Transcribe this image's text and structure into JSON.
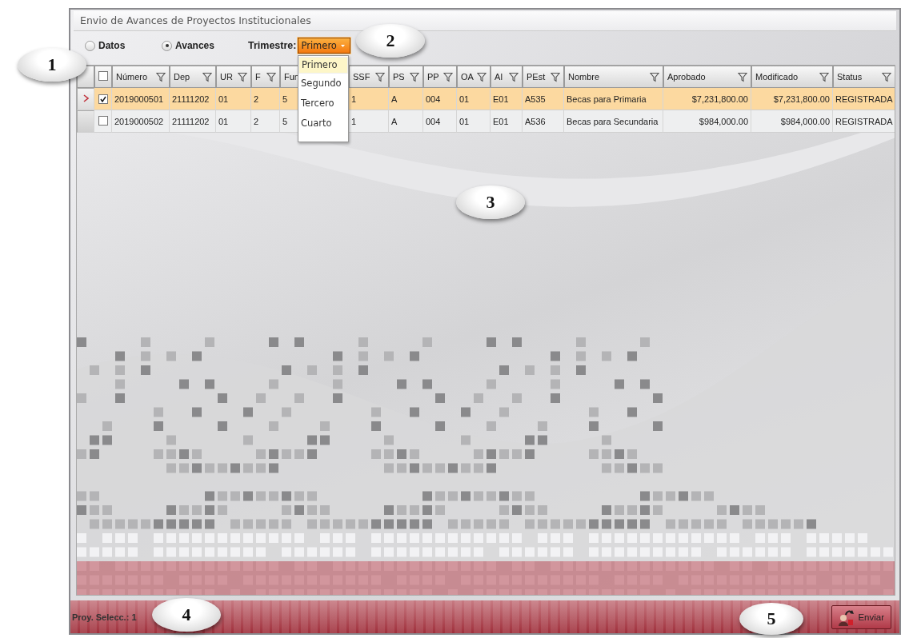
{
  "window": {
    "title": "Envio de Avances de Proyectos Institucionales"
  },
  "mode_options": [
    {
      "label": "Datos",
      "selected": false
    },
    {
      "label": "Avances",
      "selected": true
    }
  ],
  "trimestre": {
    "label": "Trimestre:",
    "value": "Primero",
    "expanded": true,
    "options": [
      {
        "label": "Primero",
        "selected": true
      },
      {
        "label": "Segundo",
        "selected": false
      },
      {
        "label": "Tercero",
        "selected": false
      },
      {
        "label": "Cuarto",
        "selected": false
      }
    ]
  },
  "table": {
    "header_checked": false,
    "columns": [
      {
        "label": "Número",
        "kind": "text"
      },
      {
        "label": "Dep",
        "kind": "text"
      },
      {
        "label": "UR",
        "kind": "text"
      },
      {
        "label": "F",
        "kind": "text"
      },
      {
        "label": "Fun",
        "kind": "text"
      },
      {
        "label": "SSF",
        "kind": "text"
      },
      {
        "label": "PS",
        "kind": "text"
      },
      {
        "label": "PP",
        "kind": "text"
      },
      {
        "label": "OA",
        "kind": "text"
      },
      {
        "label": "AI",
        "kind": "text"
      },
      {
        "label": "PEst",
        "kind": "text"
      },
      {
        "label": "Nombre",
        "kind": "text"
      },
      {
        "label": "Aprobado",
        "kind": "money"
      },
      {
        "label": "Modificado",
        "kind": "money"
      },
      {
        "label": "Status",
        "kind": "text"
      }
    ],
    "rows": [
      {
        "selected": true,
        "checked": true,
        "cells": [
          "2019000501",
          "21111202",
          "01",
          "2",
          "5",
          "1",
          "A",
          "004",
          "01",
          "E01",
          "A535",
          "Becas para Primaria",
          "$7,231,800.00",
          "$7,231,800.00",
          "REGISTRADA"
        ]
      },
      {
        "selected": false,
        "checked": false,
        "cells": [
          "2019000502",
          "21111202",
          "01",
          "2",
          "5",
          "1",
          "A",
          "004",
          "01",
          "E01",
          "A536",
          "Becas para Secundaria",
          "$984,000.00",
          "$984,000.00",
          "REGISTRADA"
        ]
      }
    ]
  },
  "status_bar": {
    "selected_count": "Proy. Selecc.: 1",
    "send_button": "Enviar"
  },
  "callouts": [
    "1",
    "2",
    "3",
    "4",
    "5"
  ]
}
